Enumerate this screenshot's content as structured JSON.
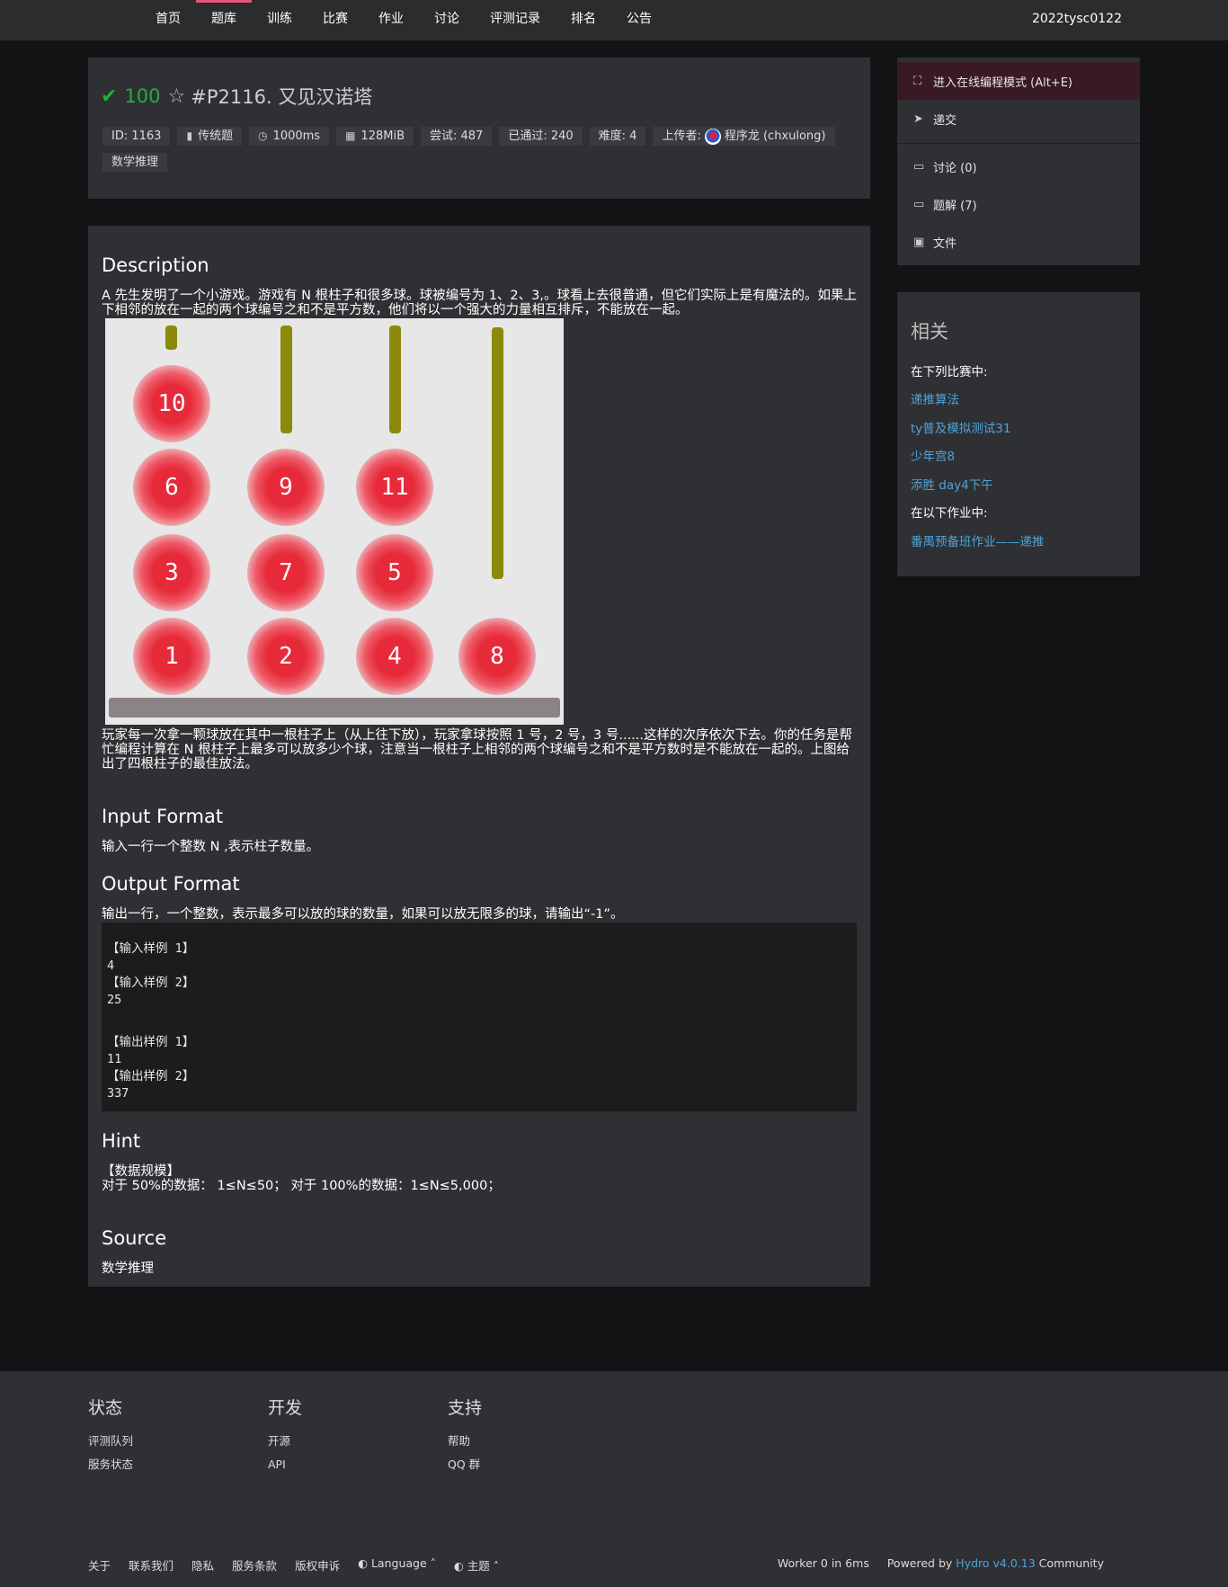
{
  "nav": {
    "items": [
      "首页",
      "题库",
      "训练",
      "比赛",
      "作业",
      "讨论",
      "评测记录",
      "排名",
      "公告"
    ],
    "active_index": 1,
    "user": "2022tysc0122"
  },
  "problem": {
    "check": "✔",
    "score": "100",
    "title": "#P2116. 又见汉诺塔",
    "meta": {
      "id": "ID: 1163",
      "type": "传统题",
      "time": "1000ms",
      "memory": "128MiB",
      "tried": "尝试: 487",
      "passed": "已通过: 240",
      "difficulty": "难度: 4",
      "uploader_label": "上传者:",
      "uploader": "程序龙 (chxulong)",
      "tag": "数学推理"
    }
  },
  "content": {
    "desc_h": "Description",
    "desc_p1": "A 先生发明了一个小游戏。游戏有 N 根柱子和很多球。球被编号为 1、2、3,。球看上去很普通，但它们实际上是有魔法的。如果上下相邻的放在一起的两个球编号之和不是平方数，他们将以一个强大的力量相互排斥，不能放在一起。",
    "desc_p2": "玩家每一次拿一颗球放在其中一根柱子上（从上往下放），玩家拿球按照 1 号，2 号，3 号......这样的次序依次下去。你的任务是帮忙编程计算在 N 根柱子上最多可以放多少个球，注意当一根柱子上相邻的两个球编号之和不是平方数时是不能放在一起的。上图给出了四根柱子的最佳放法。",
    "figure_balls": [
      "10",
      "6",
      "9",
      "11",
      "3",
      "7",
      "5",
      "1",
      "2",
      "4",
      "8"
    ],
    "input_h": "Input Format",
    "input_p": "输入一行一个整数 N ,表示柱子数量。",
    "output_h": "Output Format",
    "output_p": "输出一行，一个整数，表示最多可以放的球的数量，如果可以放无限多的球，请输出“-1”。",
    "samples": {
      "in1_label": "【输入样例 1】",
      "in1": "4",
      "in2_label": "【输入样例 2】",
      "in2": "25",
      "out1_label": "【输出样例 1】",
      "out1": "11",
      "out2_label": "【输出样例 2】",
      "out2": "337"
    },
    "hint_h": "Hint",
    "hint_l1": "【数据规模】",
    "hint_l2": "对于 50%的数据： 1≤N≤50； 对于 100%的数据：1≤N≤5,000；",
    "source_h": "Source",
    "source_p": "数学推理"
  },
  "sidebar": {
    "online": "进入在线编程模式 (Alt+E)",
    "submit": "递交",
    "discuss": "讨论 (0)",
    "solution": "题解 (7)",
    "files": "文件"
  },
  "related": {
    "title": "相关",
    "contests_label": "在下列比赛中:",
    "contests": [
      "递推算法",
      "ty普及模拟测试31",
      "少年宫8",
      "添胜 day4下午"
    ],
    "homework_label": "在以下作业中:",
    "homework": [
      "番禺预备班作业——递推"
    ]
  },
  "footer": {
    "status_h": "状态",
    "status_items": [
      "评测队列",
      "服务状态"
    ],
    "dev_h": "开发",
    "dev_items": [
      "开源",
      "API"
    ],
    "support_h": "支持",
    "support_items": [
      "帮助",
      "QQ 群"
    ],
    "bottom_links": [
      "关于",
      "联系我们",
      "隐私",
      "服务条款",
      "版权申诉"
    ],
    "language": "Language",
    "theme": "主题",
    "worker": "Worker 0 in 6ms",
    "powered_prefix": "Powered by",
    "hydro": "Hydro v4.0.13",
    "community": "Community"
  }
}
